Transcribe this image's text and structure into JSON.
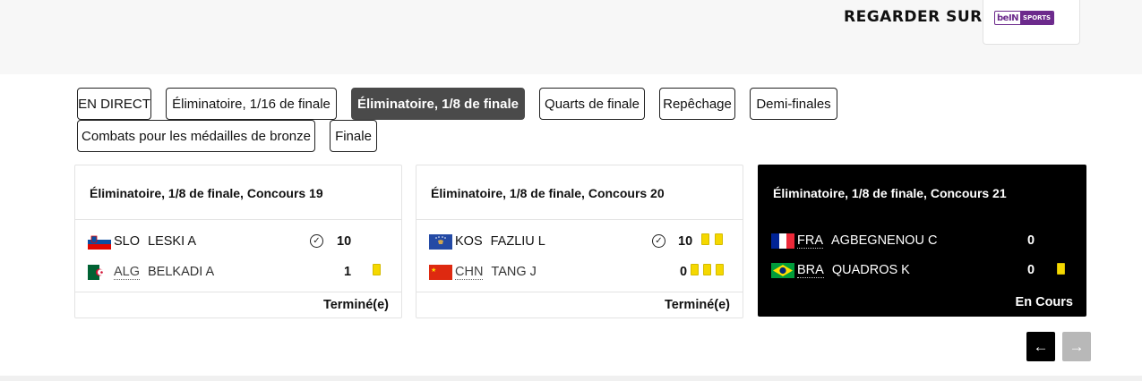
{
  "header": {
    "watch_label": "REGARDER SUR",
    "broadcaster": {
      "logo_word": "beIN",
      "logo_tag": "SPORTS"
    }
  },
  "tabs": [
    {
      "label": "EN DIRECT",
      "active": false
    },
    {
      "label": "Éliminatoire, 1/16 de finale",
      "active": false
    },
    {
      "label": "Éliminatoire, 1/8 de finale",
      "active": true
    },
    {
      "label": "Quarts de finale",
      "active": false
    },
    {
      "label": "Repêchage",
      "active": false
    },
    {
      "label": "Demi-finales",
      "active": false
    },
    {
      "label": "Combats pour les médailles de bronze",
      "active": false
    },
    {
      "label": "Finale",
      "active": false
    }
  ],
  "matches": [
    {
      "title": "Éliminatoire, 1/8 de finale, Concours 19",
      "status": "Terminé(e)",
      "live": false,
      "competitors": [
        {
          "flag": "slovenia-flag",
          "code": "SLO",
          "name": "LESKI A",
          "score": "10",
          "winner": true,
          "penalties": 0
        },
        {
          "flag": "algeria-flag",
          "code": "ALG",
          "name": "BELKADI A",
          "score": "1",
          "winner": false,
          "penalties": 1
        }
      ]
    },
    {
      "title": "Éliminatoire, 1/8 de finale, Concours 20",
      "status": "Terminé(e)",
      "live": false,
      "competitors": [
        {
          "flag": "kosovo-flag",
          "code": "KOS",
          "name": "FAZLIU L",
          "score": "10",
          "winner": true,
          "penalties": 2
        },
        {
          "flag": "china-flag",
          "code": "CHN",
          "name": "TANG J",
          "score": "0",
          "winner": false,
          "penalties": 3
        }
      ]
    },
    {
      "title": "Éliminatoire, 1/8 de finale, Concours 21",
      "status": "En Cours",
      "live": true,
      "competitors": [
        {
          "flag": "france-flag",
          "code": "FRA",
          "name": "AGBEGNENOU C",
          "score": "0",
          "winner": false,
          "penalties": 0
        },
        {
          "flag": "brazil-flag",
          "code": "BRA",
          "name": "QUADROS K",
          "score": "0",
          "winner": false,
          "penalties": 1
        }
      ]
    }
  ],
  "pager": {
    "prev_icon": "←",
    "next_icon": "→"
  },
  "colors": {
    "active_tab": "#4a4a4a",
    "live_card": "#000000",
    "penalty_card": "#f5d800"
  }
}
